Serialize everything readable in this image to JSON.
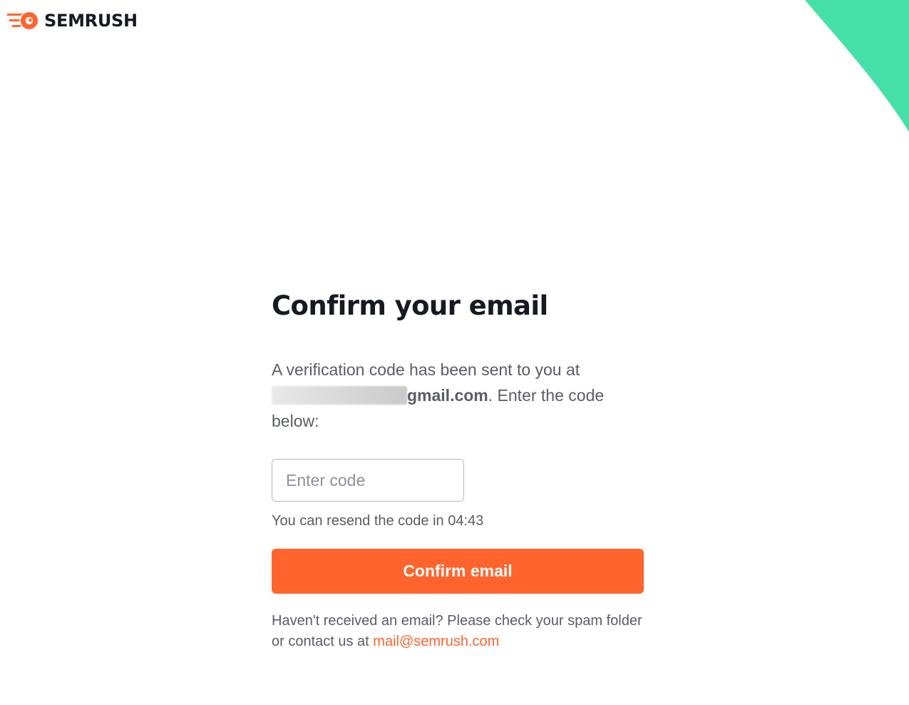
{
  "brand": {
    "name": "SEMRUSH",
    "accent_color": "#ff642d",
    "decor_color": "#45e0a7",
    "logo_icon": "semrush-fireball-icon"
  },
  "page": {
    "title": "Confirm your email"
  },
  "message": {
    "before": "A verification code has been sent to you at ",
    "email_domain": "gmail.com",
    "after": ". Enter the code below:"
  },
  "code_input": {
    "placeholder": "Enter code",
    "value": ""
  },
  "resend": {
    "text": "You can resend the code in 04:43"
  },
  "confirm_button": {
    "label": "Confirm email"
  },
  "help": {
    "text": "Haven't received an email? Please check your spam folder or contact us at ",
    "link_text": "mail@semrush.com"
  }
}
